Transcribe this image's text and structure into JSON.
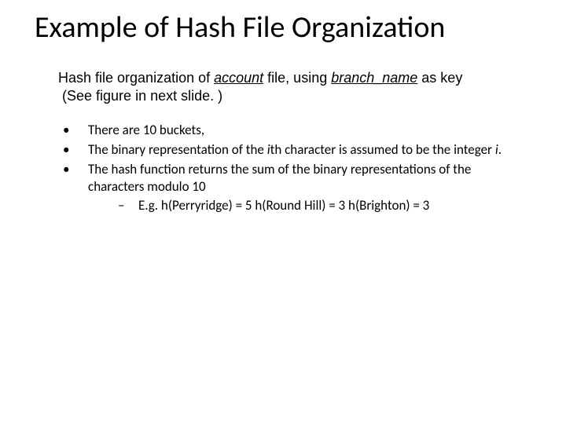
{
  "title": "Example of Hash File Organization",
  "intro": {
    "prefix": "Hash file organization of ",
    "account": "account",
    "mid": " file, using ",
    "branch": "branch_name",
    "suffix": " as key",
    "note": "(See figure in next slide. )"
  },
  "bullets": {
    "b1": "There are 10 buckets,",
    "b2_a": "The binary representation of the ",
    "b2_i": "i",
    "b2_b": "th character is assumed to be the integer ",
    "b2_i2": "i",
    "b2_c": ".",
    "b3": "The hash function returns the sum of the binary representations of the characters modulo 10",
    "sub": "E.g. h(Perryridge) = 5   h(Round Hill) = 3   h(Brighton) = 3"
  },
  "markers": {
    "dot": "•",
    "dash": "–"
  }
}
